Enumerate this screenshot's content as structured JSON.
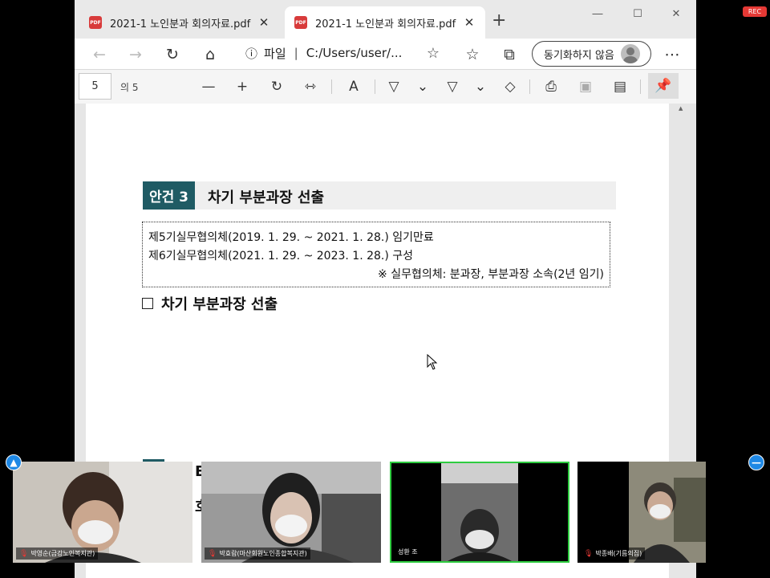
{
  "browser": {
    "tabs": [
      {
        "label": "2021-1 노인분과 회의자료.pdf",
        "icon": "pdf-icon",
        "active": false
      },
      {
        "label": "2021-1 노인분과 회의자료.pdf",
        "icon": "pdf-icon",
        "active": true
      }
    ],
    "address": {
      "scheme_label": "파일",
      "url": "C:/Users/user/..."
    },
    "sync_label": "동기화하지 않음"
  },
  "pdf_toolbar": {
    "page_number": "5",
    "page_of": "의 5"
  },
  "document": {
    "agenda_badge": "안건 3",
    "agenda_title": "차기 부분과장 선출",
    "info_lines": [
      "제5기실무협의체(2019. 1. 29. ~ 2021. 1. 28.) 임기만료",
      "제6기실무협의체(2021. 1. 29. ~ 2023. 1. 28.) 구성"
    ],
    "info_note": "※ 실무협의체: 분과장, 부분과장 소속(2년 임기)",
    "section_title": "차기 부분과장 선출",
    "partial_text_1": "E",
    "partial_text_2": "호"
  },
  "recording": {
    "label": "REC",
    "color": "#e53935"
  },
  "participants": [
    {
      "name": "박영순(금강노인복지관)",
      "muted": true
    },
    {
      "name": "박효람(마산회원노인종합복지관)",
      "muted": true
    },
    {
      "name": "성환 조",
      "muted": false,
      "speaking": true
    },
    {
      "name": "박종배(기름의집)",
      "muted": true
    }
  ],
  "colors": {
    "accent": "#1f5b64",
    "speaking_border": "#2ecc40",
    "control_blue": "#1e88e5"
  }
}
